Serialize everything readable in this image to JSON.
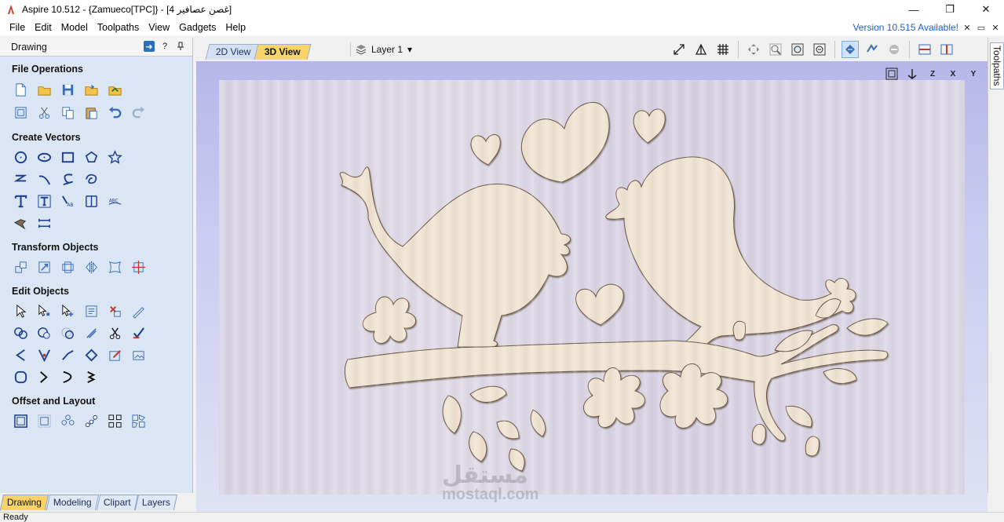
{
  "window": {
    "title": "Aspire 10.512 - {Zamueco[TPC]} - [غصن عصافير 4]",
    "controls": [
      "—",
      "❐",
      "✕"
    ]
  },
  "menu": {
    "items": [
      "File",
      "Edit",
      "Model",
      "Toolpaths",
      "View",
      "Gadgets",
      "Help"
    ],
    "version_notice": "Version 10.515 Available!",
    "mdi": [
      "✕",
      "▭",
      "✕"
    ]
  },
  "panel": {
    "title": "Drawing",
    "help": "?",
    "sections": {
      "file_ops": "File Operations",
      "create_vectors": "Create Vectors",
      "transform": "Transform Objects",
      "edit": "Edit Objects",
      "offset": "Offset and Layout"
    },
    "tabs": [
      "Drawing",
      "Modeling",
      "Clipart",
      "Layers"
    ]
  },
  "views": {
    "tab_2d": "2D View",
    "tab_3d": "3D View",
    "layer": "Layer 1"
  },
  "viewport_icons": [
    "Z",
    "X",
    "Y"
  ],
  "right_tab": "Toolpaths",
  "watermark": {
    "arabic": "مستقل",
    "latin": "mostaql.com"
  },
  "status": "Ready",
  "colors": {
    "accent_tab": "#f7d36a",
    "panel_bg": "#dbe6f4",
    "wood": "#efe3d2",
    "link": "#1e5fd1"
  }
}
